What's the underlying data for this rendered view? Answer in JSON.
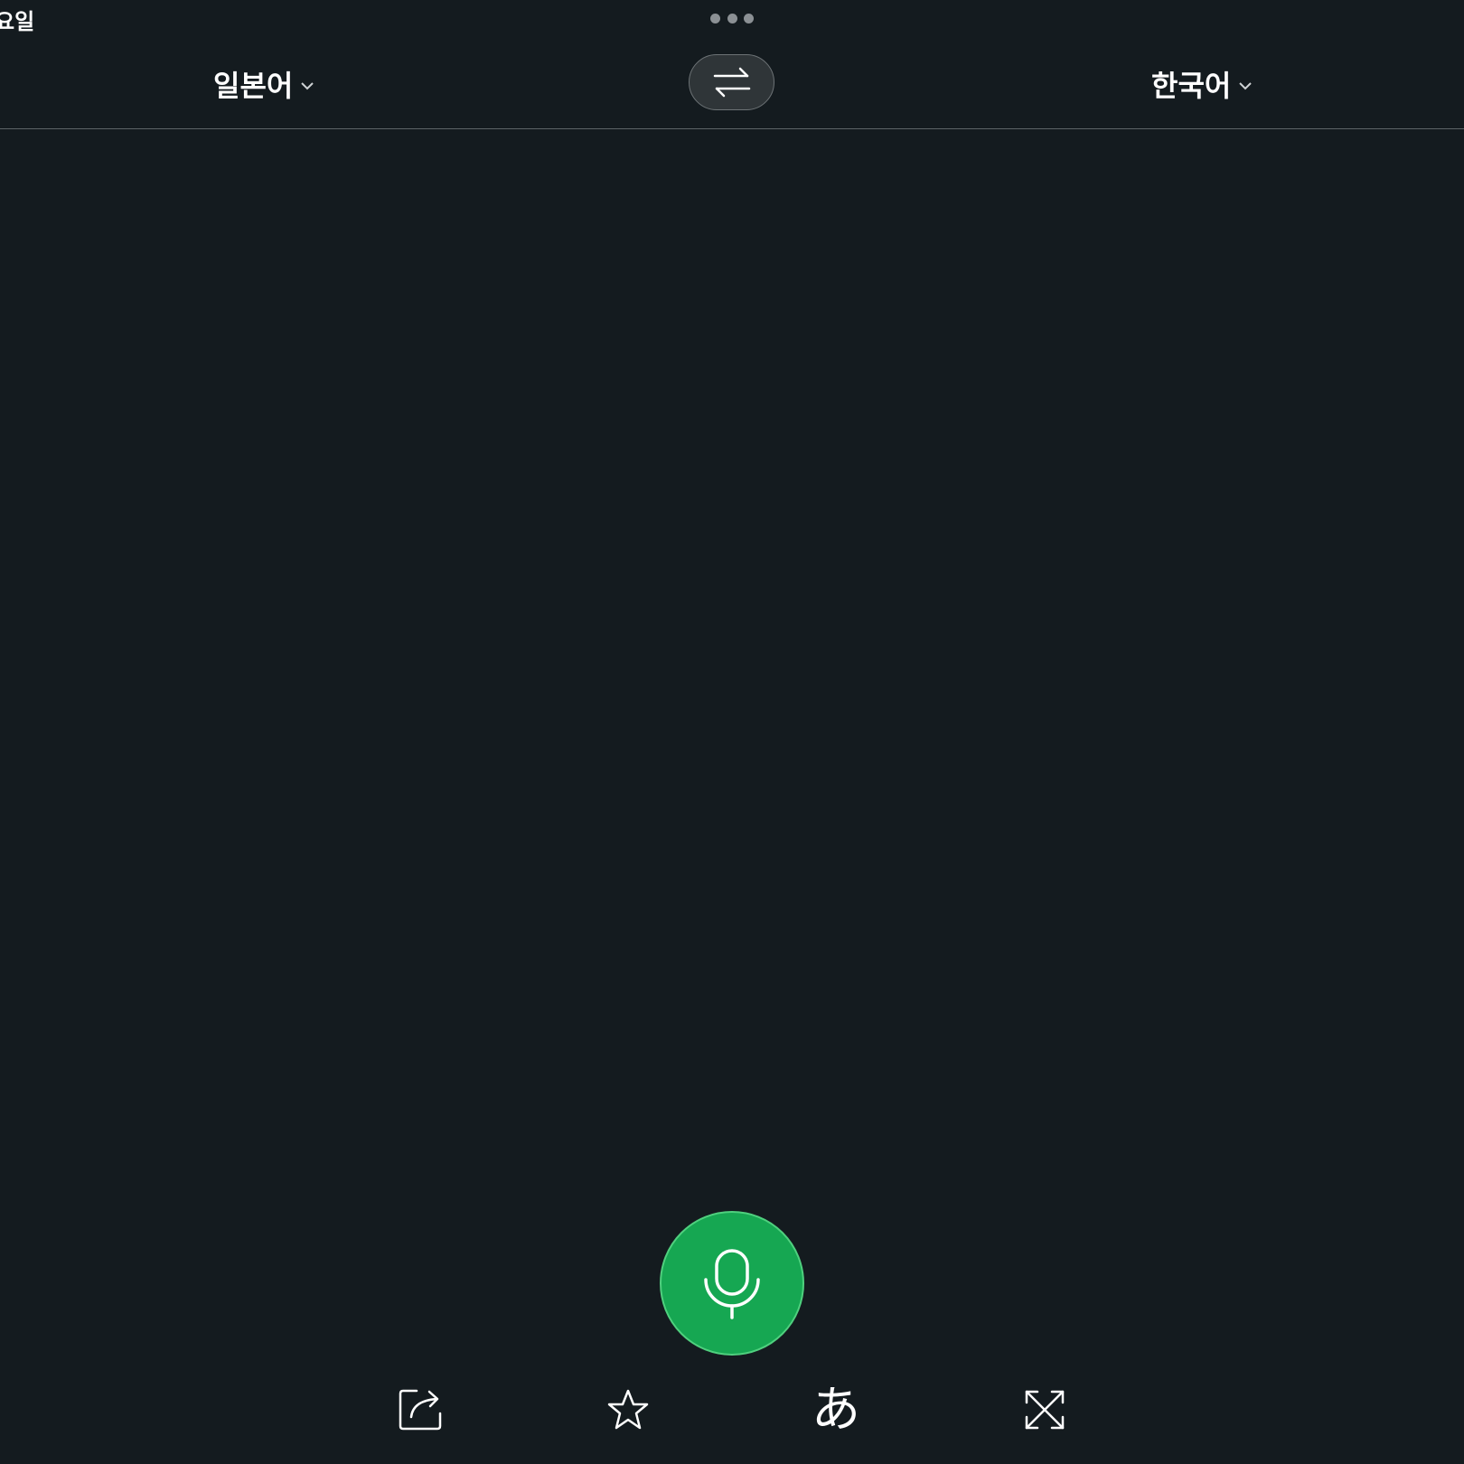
{
  "status_bar": {
    "date_text": "요일"
  },
  "language_bar": {
    "source_language": "일본어",
    "target_language": "한국어",
    "swap_icon": "swap-arrows-icon"
  },
  "toolbar": {
    "mic_icon": "microphone-icon",
    "share_icon": "share-icon",
    "favorite_icon": "star-icon",
    "script_glyph": "あ",
    "fullscreen_icon": "expand-icon"
  },
  "colors": {
    "background": "#141b1f",
    "mic_green": "#16a752",
    "swap_bg": "#2f3538"
  }
}
